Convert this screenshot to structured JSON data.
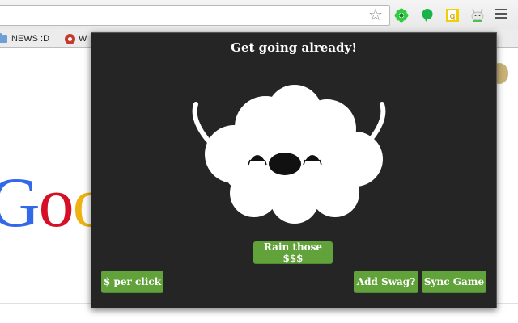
{
  "browser": {
    "omnibox_value": "",
    "extensions": [
      {
        "icon": "green-flower-icon",
        "color": "#2ecc40"
      },
      {
        "icon": "speech-bubble-icon",
        "color": "#19b34b"
      },
      {
        "icon": "q-icon",
        "color": "#f0d000",
        "letter": "q"
      },
      {
        "icon": "cloud-creature-icon",
        "color": "#aaaaaa"
      }
    ]
  },
  "bookmarks": [
    {
      "label": "NEWS :D",
      "icon": "folder-icon"
    },
    {
      "label": "W",
      "icon": "site-favicon"
    }
  ],
  "page": {
    "logo_letters": [
      "G",
      "o",
      "o"
    ]
  },
  "popup": {
    "title": "Get going already!",
    "buttons": {
      "rain": "Rain those $$$",
      "per_click": "$ per click",
      "add_swag": "Add Swag?",
      "sync": "Sync Game"
    },
    "accent_color": "#62a23a",
    "background_color": "#252525"
  }
}
